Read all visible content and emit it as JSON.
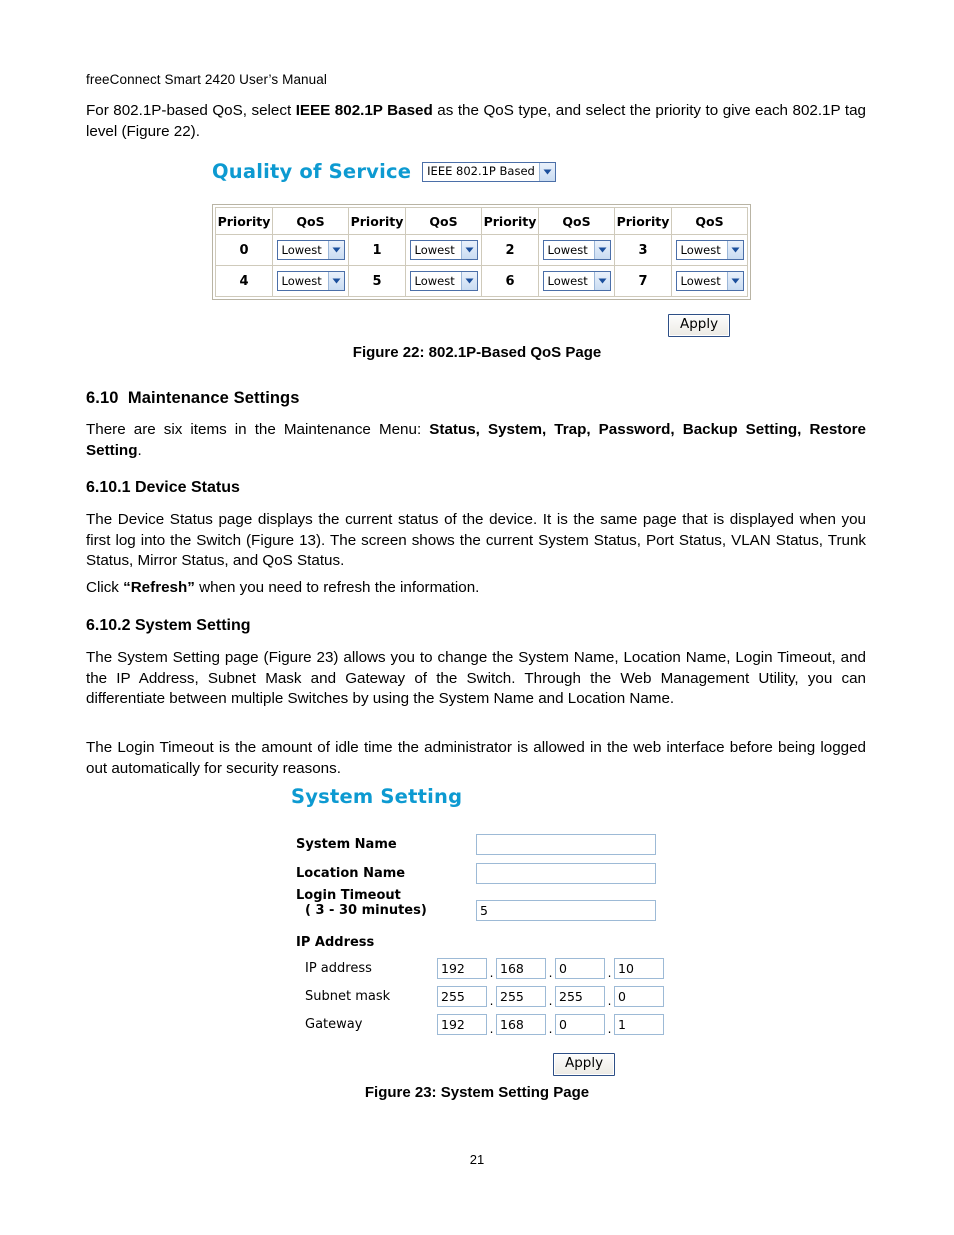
{
  "document": {
    "running_header": "freeConnect Smart 2420 User’s Manual",
    "page_number": "21",
    "intro_paragraph_pre": "For 802.1P-based QoS, select ",
    "intro_paragraph_bold": "IEEE 802.1P Based",
    "intro_paragraph_post": " as the QoS type, and select the priority to give each 802.1P tag level (Figure 22)."
  },
  "qos_figure": {
    "ui_title": "Quality of Service",
    "qos_type_selected": "IEEE 802.1P Based",
    "headers": [
      "Priority",
      "QoS",
      "Priority",
      "QoS",
      "Priority",
      "QoS",
      "Priority",
      "QoS"
    ],
    "rows": [
      {
        "cells": [
          {
            "priority": "0",
            "qos": "Lowest"
          },
          {
            "priority": "1",
            "qos": "Lowest"
          },
          {
            "priority": "2",
            "qos": "Lowest"
          },
          {
            "priority": "3",
            "qos": "Lowest"
          }
        ]
      },
      {
        "cells": [
          {
            "priority": "4",
            "qos": "Lowest"
          },
          {
            "priority": "5",
            "qos": "Lowest"
          },
          {
            "priority": "6",
            "qos": "Lowest"
          },
          {
            "priority": "7",
            "qos": "Lowest"
          }
        ]
      }
    ],
    "apply_label": "Apply",
    "caption": "Figure 22: 802.1P-Based QoS Page"
  },
  "sections": {
    "maintenance": {
      "number": "6.10",
      "title": "Maintenance Settings",
      "body_pre": "There are six items in the Maintenance Menu: ",
      "body_bold": "Status, System, Trap, Password, Backup Setting, Restore Setting",
      "body_post": "."
    },
    "device_status": {
      "number": "6.10.1",
      "title": "Device Status",
      "paragraph": "The Device Status page displays the current status of the device.  It is the same page that is displayed when you first log into the Switch (Figure 13).  The screen shows the current System Status, Port Status, VLAN Status, Trunk Status, Mirror Status, and QoS Status.",
      "refresh_pre": "Click ",
      "refresh_bold": "“Refresh”",
      "refresh_post": " when you need to refresh the information."
    },
    "system_setting": {
      "number": "6.10.2",
      "title": "System Setting",
      "paragraph_1": "The System Setting page (Figure 23) allows you to change the System Name, Location Name, Login Timeout, and the IP Address, Subnet Mask and Gateway of the Switch. Through the Web Management Utility, you can differentiate between multiple Switches by using the System Name and Location Name.",
      "paragraph_2": "The Login Timeout is the amount of idle time the administrator is allowed in the web interface before being logged out automatically for security reasons."
    }
  },
  "system_setting_figure": {
    "ui_title": "System Setting",
    "fields": {
      "system_name_label": "System Name",
      "system_name_value": "",
      "location_name_label": "Location Name",
      "location_name_value": "",
      "login_timeout_label": "Login Timeout",
      "login_timeout_sublabel": "( 3 - 30 minutes)",
      "login_timeout_value": "5"
    },
    "ip_section": {
      "heading": "IP Address",
      "rows": [
        {
          "label": "IP address",
          "octets": [
            "192",
            "168",
            "0",
            "10"
          ]
        },
        {
          "label": "Subnet mask",
          "octets": [
            "255",
            "255",
            "255",
            "0"
          ]
        },
        {
          "label": "Gateway",
          "octets": [
            "192",
            "168",
            "0",
            "1"
          ]
        }
      ],
      "separator": "."
    },
    "apply_label": "Apply",
    "caption": "Figure 23: System Setting Page"
  },
  "colors": {
    "ui_heading": "#0d9ad1",
    "input_border": "#9dbad6",
    "select_border": "#4b6fa8",
    "table_border": "#cfcabb",
    "button_border": "#2e4f86"
  }
}
